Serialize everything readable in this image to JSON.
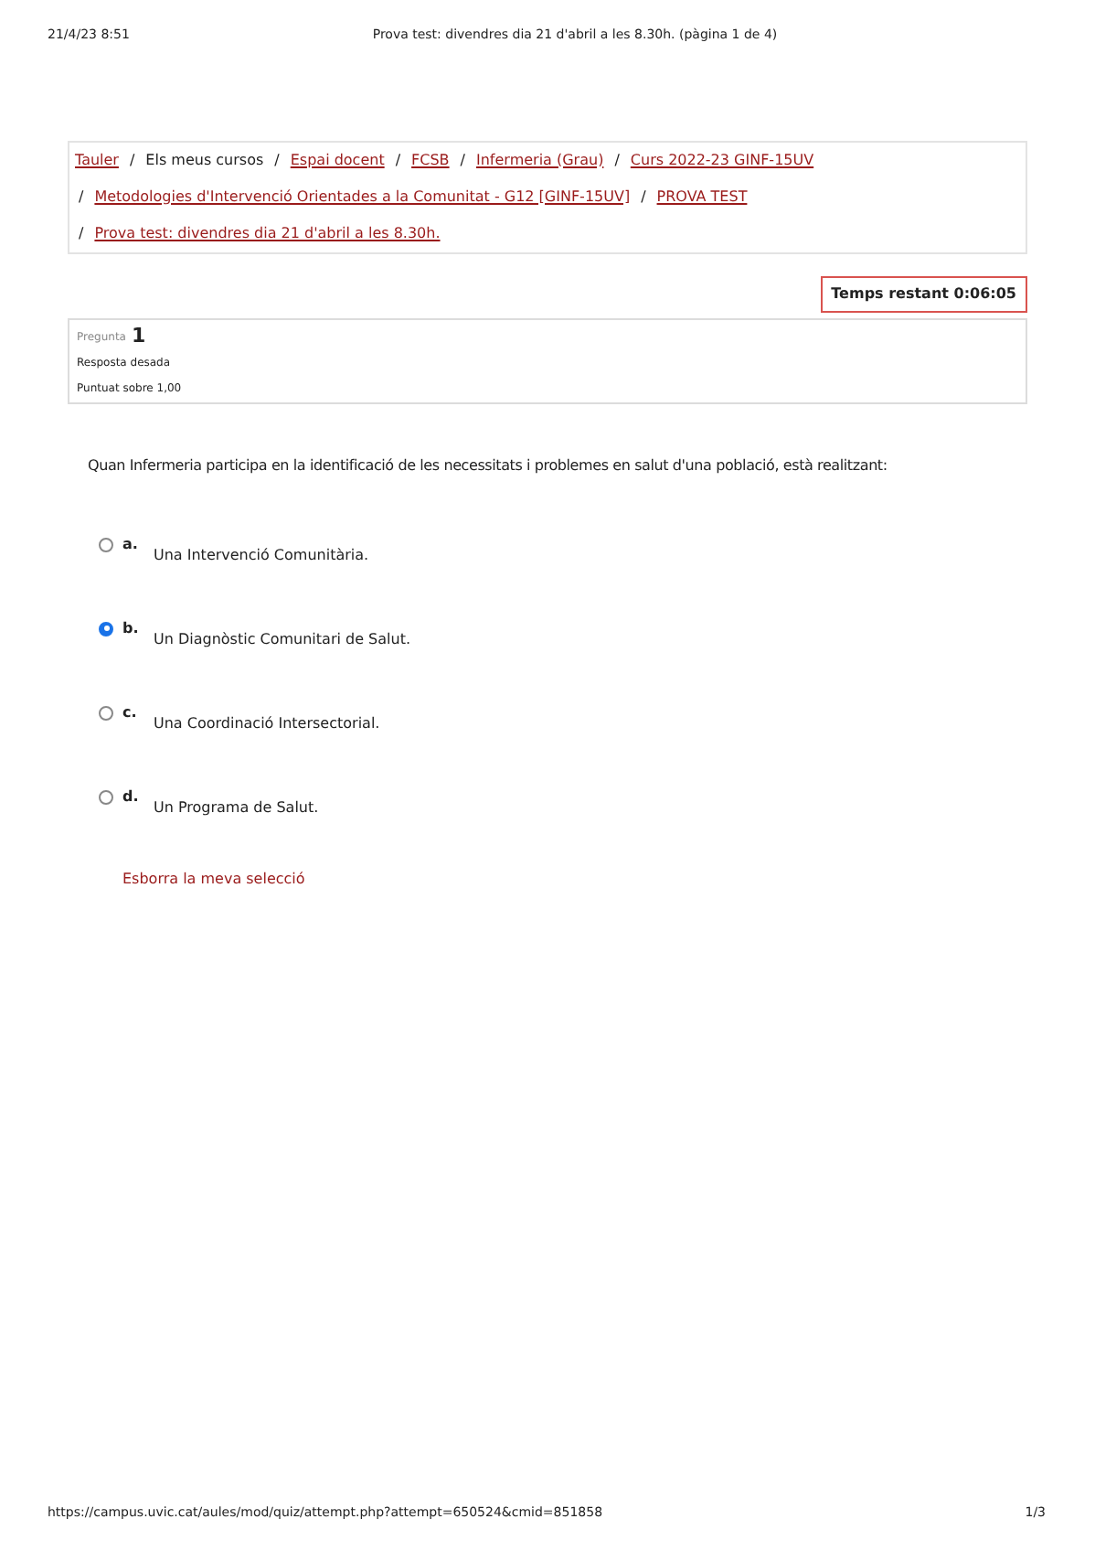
{
  "print_header": {
    "datetime": "21/4/23 8:51",
    "title": "Prova test: divendres dia 21 d'abril a les 8.30h. (pàgina 1 de 4)"
  },
  "breadcrumb": {
    "items": [
      {
        "label": "Tauler",
        "kind": "link"
      },
      {
        "separator": "/",
        "label": "Els meus cursos",
        "kind": "text"
      },
      {
        "separator": "/",
        "label": "Espai docent",
        "kind": "link"
      },
      {
        "separator": "/",
        "label": "FCSB",
        "kind": "link"
      },
      {
        "separator": "/",
        "label": "Infermeria (Grau)",
        "kind": "link"
      },
      {
        "separator": "/",
        "label": "Curs 2022-23 GINF-15UV",
        "kind": "link"
      },
      {
        "separator": "/",
        "label": "Metodologies d'Intervenció Orientades a la Comunitat - G12 [GINF-15UV]",
        "kind": "link"
      },
      {
        "separator": "/",
        "label": "PROVA TEST",
        "kind": "link"
      },
      {
        "separator": "/",
        "label": "Prova test: divendres dia 21 d'abril a les 8.30h.",
        "kind": "link"
      }
    ]
  },
  "timer": {
    "label": "Temps restant",
    "value": "0:06:05"
  },
  "question_info": {
    "label": "Pregunta",
    "number": "1",
    "status": "Resposta desada",
    "marks": "Puntuat sobre 1,00"
  },
  "question": {
    "text": "Quan Infermeria participa en la identificació de les necessitats i problemes en salut d'una població, està realitzant:",
    "options": [
      {
        "letter": "a.",
        "text": "Una Intervenció Comunitària.",
        "selected": false
      },
      {
        "letter": "b.",
        "text": "Un Diagnòstic Comunitari de Salut.",
        "selected": true
      },
      {
        "letter": "c.",
        "text": "Una Coordinació Intersectorial.",
        "selected": false
      },
      {
        "letter": "d.",
        "text": "Un Programa de Salut.",
        "selected": false
      }
    ],
    "clear_link": "Esborra la meva selecció"
  },
  "print_footer": {
    "url": "https://campus.uvic.cat/aules/mod/quiz/attempt.php?attempt=650524&cmid=851858",
    "page": "1/3"
  }
}
